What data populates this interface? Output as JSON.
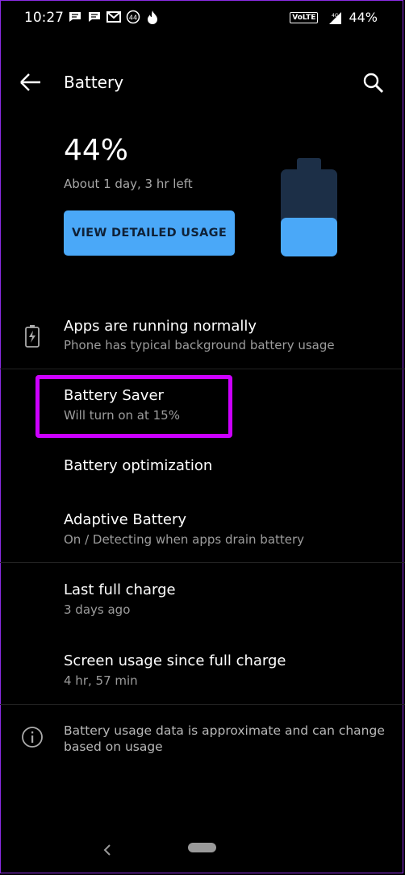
{
  "status_bar": {
    "time": "10:27",
    "notification_badge": "44",
    "volte": "VoLTE",
    "network": "4G",
    "battery_percent": "44%"
  },
  "app_bar": {
    "title": "Battery"
  },
  "battery_summary": {
    "percent": "44%",
    "remaining": "About 1 day, 3 hr left",
    "level_fraction": 0.44,
    "details_button": "VIEW DETAILED USAGE"
  },
  "items": [
    {
      "key": "apps-status",
      "primary": "Apps are running normally",
      "secondary": "Phone has typical background battery usage"
    },
    {
      "key": "battery-saver",
      "primary": "Battery Saver",
      "secondary": "Will turn on at 15%"
    },
    {
      "key": "battery-optimization",
      "primary": "Battery optimization",
      "secondary": ""
    },
    {
      "key": "adaptive-battery",
      "primary": "Adaptive Battery",
      "secondary": "On / Detecting when apps drain battery"
    },
    {
      "key": "last-full-charge",
      "primary": "Last full charge",
      "secondary": "3 days ago"
    },
    {
      "key": "screen-usage",
      "primary": "Screen usage since full charge",
      "secondary": "4 hr, 57 min"
    }
  ],
  "footer_note": "Battery usage data is approximate and can change based on usage",
  "colors": {
    "accent": "#4aa8f8",
    "battery_empty": "#1c2f47",
    "highlight": "#cc00ff",
    "background": "#000000"
  }
}
